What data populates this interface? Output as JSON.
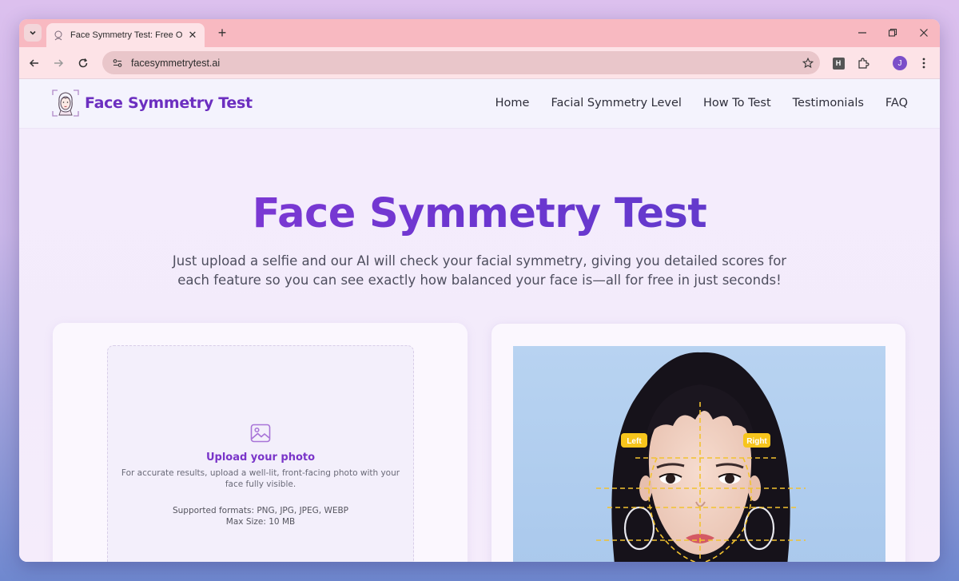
{
  "browser": {
    "tab_title": "Face Symmetry Test: Free Online",
    "url": "facesymmetrytest.ai",
    "extension_label": "H",
    "profile_initial": "J"
  },
  "site": {
    "logo_text": "Face Symmetry Test",
    "nav": [
      "Home",
      "Facial Symmetry Level",
      "How To Test",
      "Testimonials",
      "FAQ"
    ]
  },
  "hero": {
    "title": "Face Symmetry Test",
    "subtitle": "Just upload a selfie and our AI will check your facial symmetry, giving you detailed scores for each feature so you can see exactly how balanced your face is—all for free in just seconds!"
  },
  "upload": {
    "title": "Upload your photo",
    "description": "For accurate results, upload a well-lit, front-facing photo with your face fully visible.",
    "formats": "Supported formats: PNG, JPG, JPEG, WEBP",
    "max_size": "Max Size: 10 MB"
  },
  "sample": {
    "left_label": "Left",
    "right_label": "Right"
  },
  "colors": {
    "brand": "#6c2fc0",
    "accent_gradient_start": "#8a3bd6",
    "accent_gradient_end": "#5a3fc8",
    "guide_line": "#f2c230",
    "tabstrip": "#f8b9c1"
  }
}
